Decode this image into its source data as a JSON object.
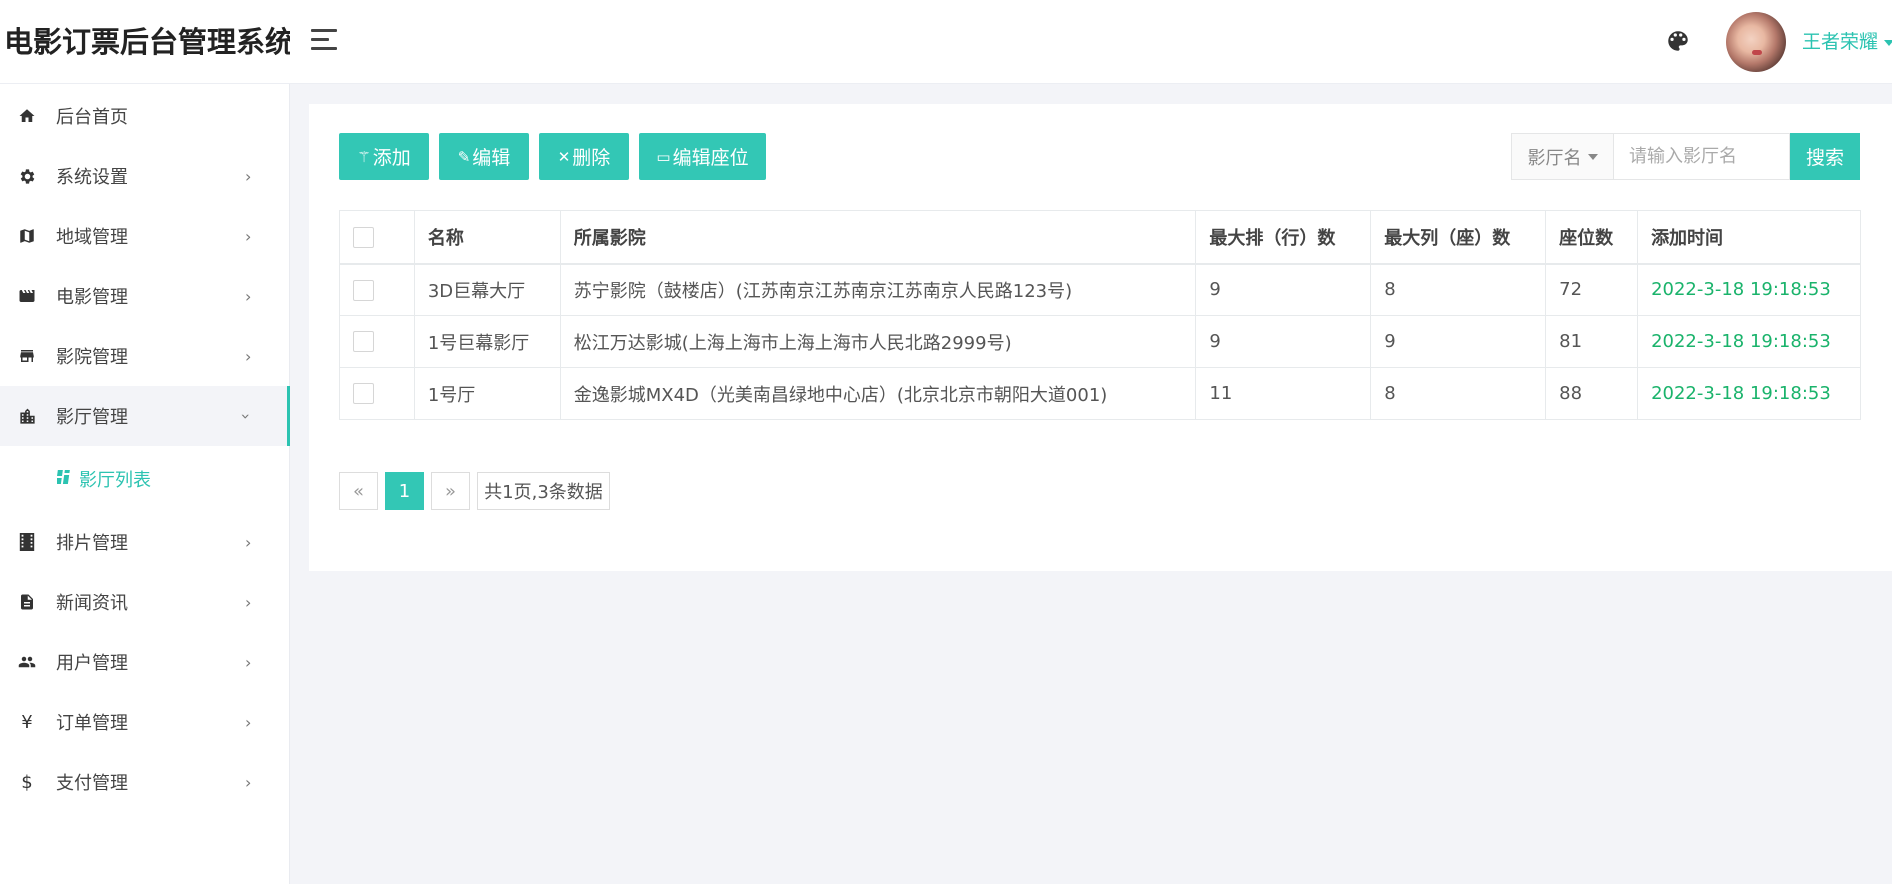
{
  "app": {
    "title": "电影订票后台管理系统"
  },
  "header": {
    "username": "王者荣耀"
  },
  "sidebar": {
    "items": [
      {
        "label": "后台首页",
        "icon": "home-icon"
      },
      {
        "label": "系统设置",
        "icon": "gear-icon"
      },
      {
        "label": "地域管理",
        "icon": "map-icon"
      },
      {
        "label": "电影管理",
        "icon": "film-icon"
      },
      {
        "label": "影院管理",
        "icon": "store-icon"
      },
      {
        "label": "影厅管理",
        "icon": "building-icon"
      },
      {
        "label": "排片管理",
        "icon": "film-strip-icon"
      },
      {
        "label": "新闻资讯",
        "icon": "news-icon"
      },
      {
        "label": "用户管理",
        "icon": "users-icon"
      },
      {
        "label": "订单管理",
        "icon": "yen-icon"
      },
      {
        "label": "支付管理",
        "icon": "dollar-icon"
      }
    ],
    "sub_item": {
      "label": "影厅列表",
      "icon": "list-icon"
    }
  },
  "toolbar": {
    "add_label": "添加",
    "edit_label": "编辑",
    "delete_label": "删除",
    "seats_label": "编辑座位"
  },
  "search": {
    "field_label": "影厅名",
    "placeholder": "请输入影厅名",
    "button_label": "搜索"
  },
  "table": {
    "columns": [
      "名称",
      "所属影院",
      "最大排（行）数",
      "最大列（座）数",
      "座位数",
      "添加时间"
    ],
    "rows": [
      [
        "3D巨幕大厅",
        "苏宁影院（鼓楼店）(江苏南京江苏南京江苏南京人民路123号)",
        "9",
        "8",
        "72",
        "2022-3-18 19:18:53"
      ],
      [
        "1号巨幕影厅",
        "松江万达影城(上海上海市上海上海市人民北路2999号)",
        "9",
        "9",
        "81",
        "2022-3-18 19:18:53"
      ],
      [
        "1号厅",
        "金逸影城MX4D（光美南昌绿地中心店）(北京北京市朝阳大道001)",
        "11",
        "8",
        "88",
        "2022-3-18 19:18:53"
      ]
    ]
  },
  "pagination": {
    "prev": "«",
    "current": "1",
    "next": "»",
    "info": "共1页,3条数据"
  },
  "colors": {
    "accent": "#33c7b5",
    "time": "#1ab36b"
  }
}
